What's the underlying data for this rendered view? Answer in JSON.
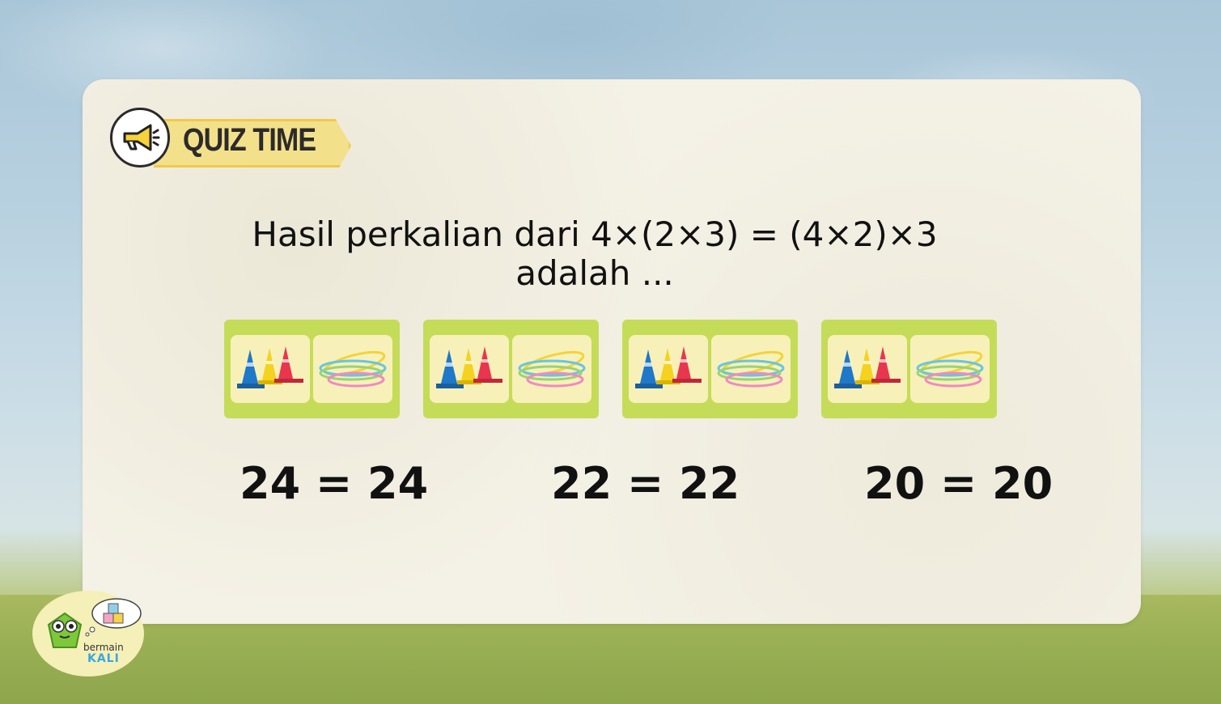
{
  "badge": {
    "label": "QUIZ TIME",
    "icon": "megaphone-icon"
  },
  "question": {
    "line1": "Hasil perkalian dari 4×(2×3) = (4×2)×3",
    "line2": "adalah ..."
  },
  "groups": [
    {
      "items": [
        "traffic-cones-icon",
        "hula-hoops-icon"
      ]
    },
    {
      "items": [
        "traffic-cones-icon",
        "hula-hoops-icon"
      ]
    },
    {
      "items": [
        "traffic-cones-icon",
        "hula-hoops-icon"
      ]
    },
    {
      "items": [
        "traffic-cones-icon",
        "hula-hoops-icon"
      ]
    }
  ],
  "answers": [
    {
      "label": "24 = 24"
    },
    {
      "label": "22 = 22"
    },
    {
      "label": "20 = 20"
    }
  ],
  "logo": {
    "line1": "bermain",
    "line2": "KALI",
    "blocks": "K L A I"
  },
  "colors": {
    "card": "#f4f1e6",
    "group_bg": "#c5dc58",
    "tile_bg": "#f7f1b9",
    "badge_fill": "#f3e08a",
    "badge_border": "#f0c94c"
  }
}
